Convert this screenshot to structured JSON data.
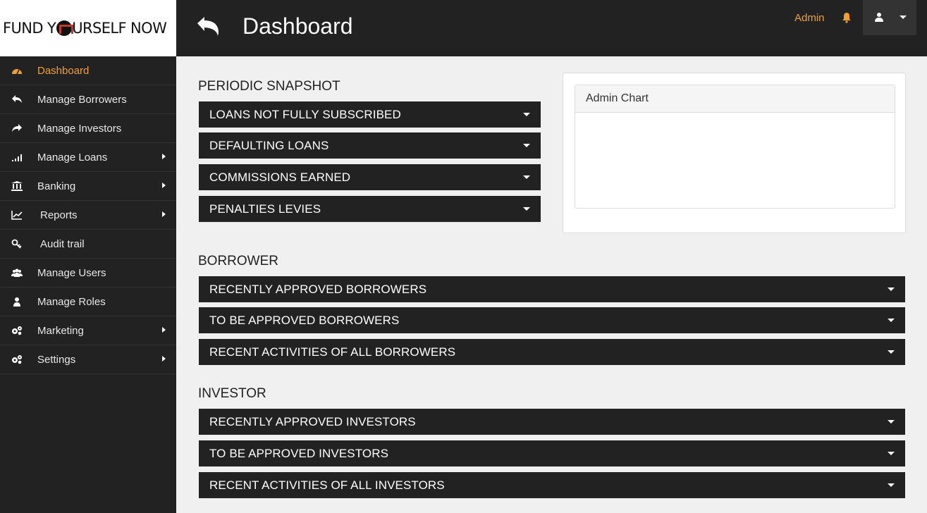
{
  "logo": {
    "text_left": "FUND Y",
    "text_right": "URSELF NOW"
  },
  "header": {
    "title": "Dashboard",
    "admin_label": "Admin"
  },
  "sidebar": {
    "items": [
      {
        "label": "Dashboard",
        "icon": "dashboard-icon",
        "active": true,
        "has_submenu": false
      },
      {
        "label": "Manage Borrowers",
        "icon": "reply-icon",
        "active": false,
        "has_submenu": false
      },
      {
        "label": "Manage Investors",
        "icon": "share-icon",
        "active": false,
        "has_submenu": false
      },
      {
        "label": "Manage Loans",
        "icon": "signal-bars-icon",
        "active": false,
        "has_submenu": true
      },
      {
        "label": "Banking",
        "icon": "bank-icon",
        "active": false,
        "has_submenu": true
      },
      {
        "label": "Reports",
        "icon": "line-chart-icon",
        "active": false,
        "has_submenu": true
      },
      {
        "label": "Audit trail",
        "icon": "key-icon",
        "active": false,
        "has_submenu": false
      },
      {
        "label": "Manage Users",
        "icon": "users-icon",
        "active": false,
        "has_submenu": false
      },
      {
        "label": "Manage Roles",
        "icon": "user-icon",
        "active": false,
        "has_submenu": false
      },
      {
        "label": "Marketing",
        "icon": "cogs-icon",
        "active": false,
        "has_submenu": true
      },
      {
        "label": "Settings",
        "icon": "cogs-icon",
        "active": false,
        "has_submenu": true
      }
    ]
  },
  "snapshot": {
    "title": "PERIODIC SNAPSHOT",
    "items": [
      "LOANS NOT FULLY SUBSCRIBED",
      "DEFAULTING LOANS",
      "COMMISSIONS EARNED",
      "PENALTIES LEVIES"
    ]
  },
  "chart_panel": {
    "title": "Admin Chart"
  },
  "borrower": {
    "title": "BORROWER",
    "items": [
      "RECENTLY APPROVED BORROWERS",
      "TO BE APPROVED BORROWERS",
      "RECENT ACTIVITIES OF ALL BORROWERS"
    ]
  },
  "investor": {
    "title": "INVESTOR",
    "items": [
      "RECENTLY APPROVED INVESTORS",
      "TO BE APPROVED INVESTORS",
      "RECENT ACTIVITIES OF ALL INVESTORS"
    ]
  },
  "colors": {
    "accent": "#f0a030",
    "dark": "#222222",
    "background": "#f0f0f0"
  }
}
